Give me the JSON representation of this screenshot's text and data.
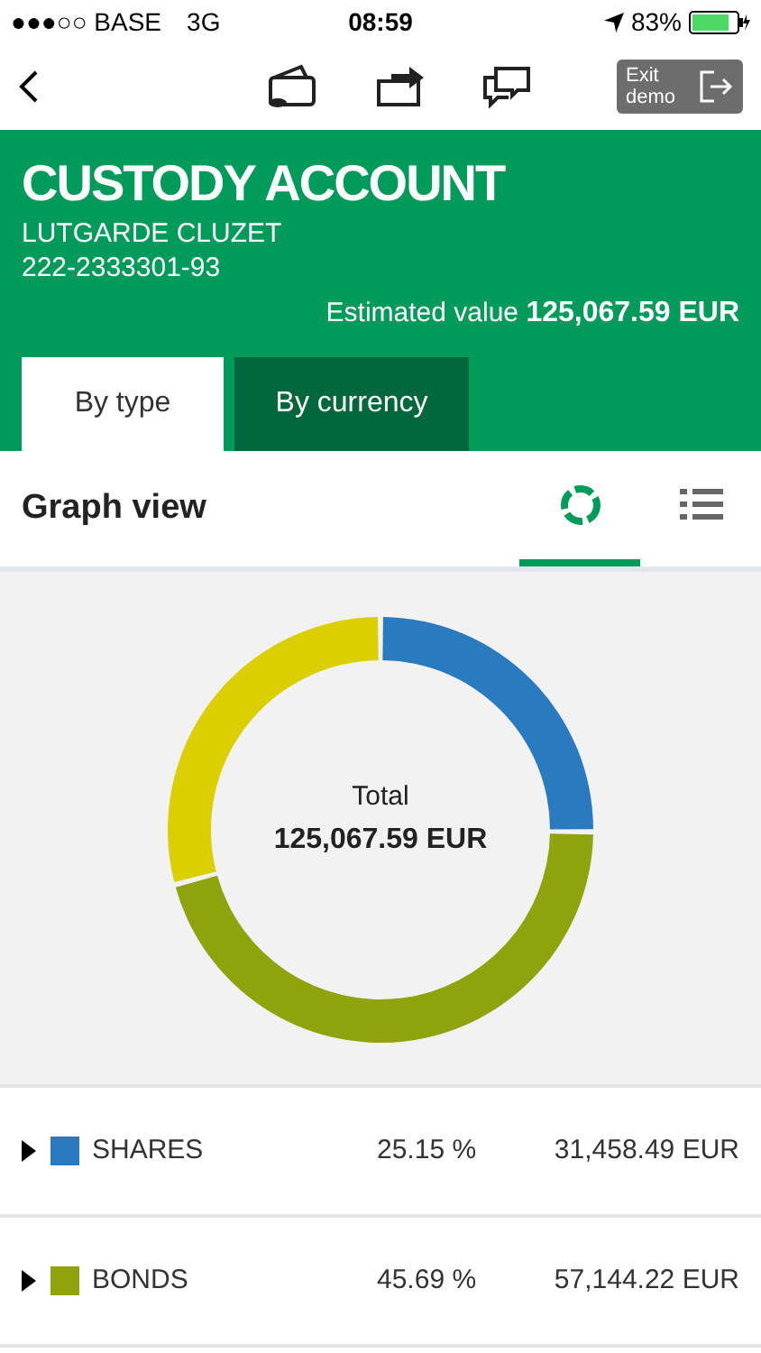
{
  "status_bar": {
    "carrier": "●●●○○ BASE",
    "network": "3G",
    "time": "08:59",
    "battery": "83%"
  },
  "nav": {
    "exit_button": "Exit demo"
  },
  "account": {
    "title": "CUSTODY ACCOUNT",
    "holder": "LUTGARDE CLUZET",
    "number": "222-2333301-93",
    "estimated_label": "Estimated value",
    "estimated_value": "125,067.59 EUR"
  },
  "tabs": [
    {
      "label": "By type",
      "selected": true
    },
    {
      "label": "By currency",
      "selected": false
    }
  ],
  "view": {
    "title": "Graph view",
    "modes": [
      {
        "kind": "graph",
        "selected": true
      },
      {
        "kind": "list",
        "selected": false
      }
    ]
  },
  "chart": {
    "total_label": "Total",
    "total_value": "125,067.59 EUR",
    "chart_data": {
      "type": "donut",
      "values": [
        25.15,
        45.69,
        29.16
      ],
      "colors": [
        "#2a7ac0",
        "#8ea30c",
        "#dccf00"
      ]
    }
  },
  "rows": [
    {
      "name": "SHARES",
      "color": "#2a7ac0",
      "percent": "25.15 %",
      "amount": "31,458.49 EUR"
    },
    {
      "name": "BONDS",
      "color": "#8ea30c",
      "percent": "45.69 %",
      "amount": "57,144.22 EUR"
    }
  ]
}
